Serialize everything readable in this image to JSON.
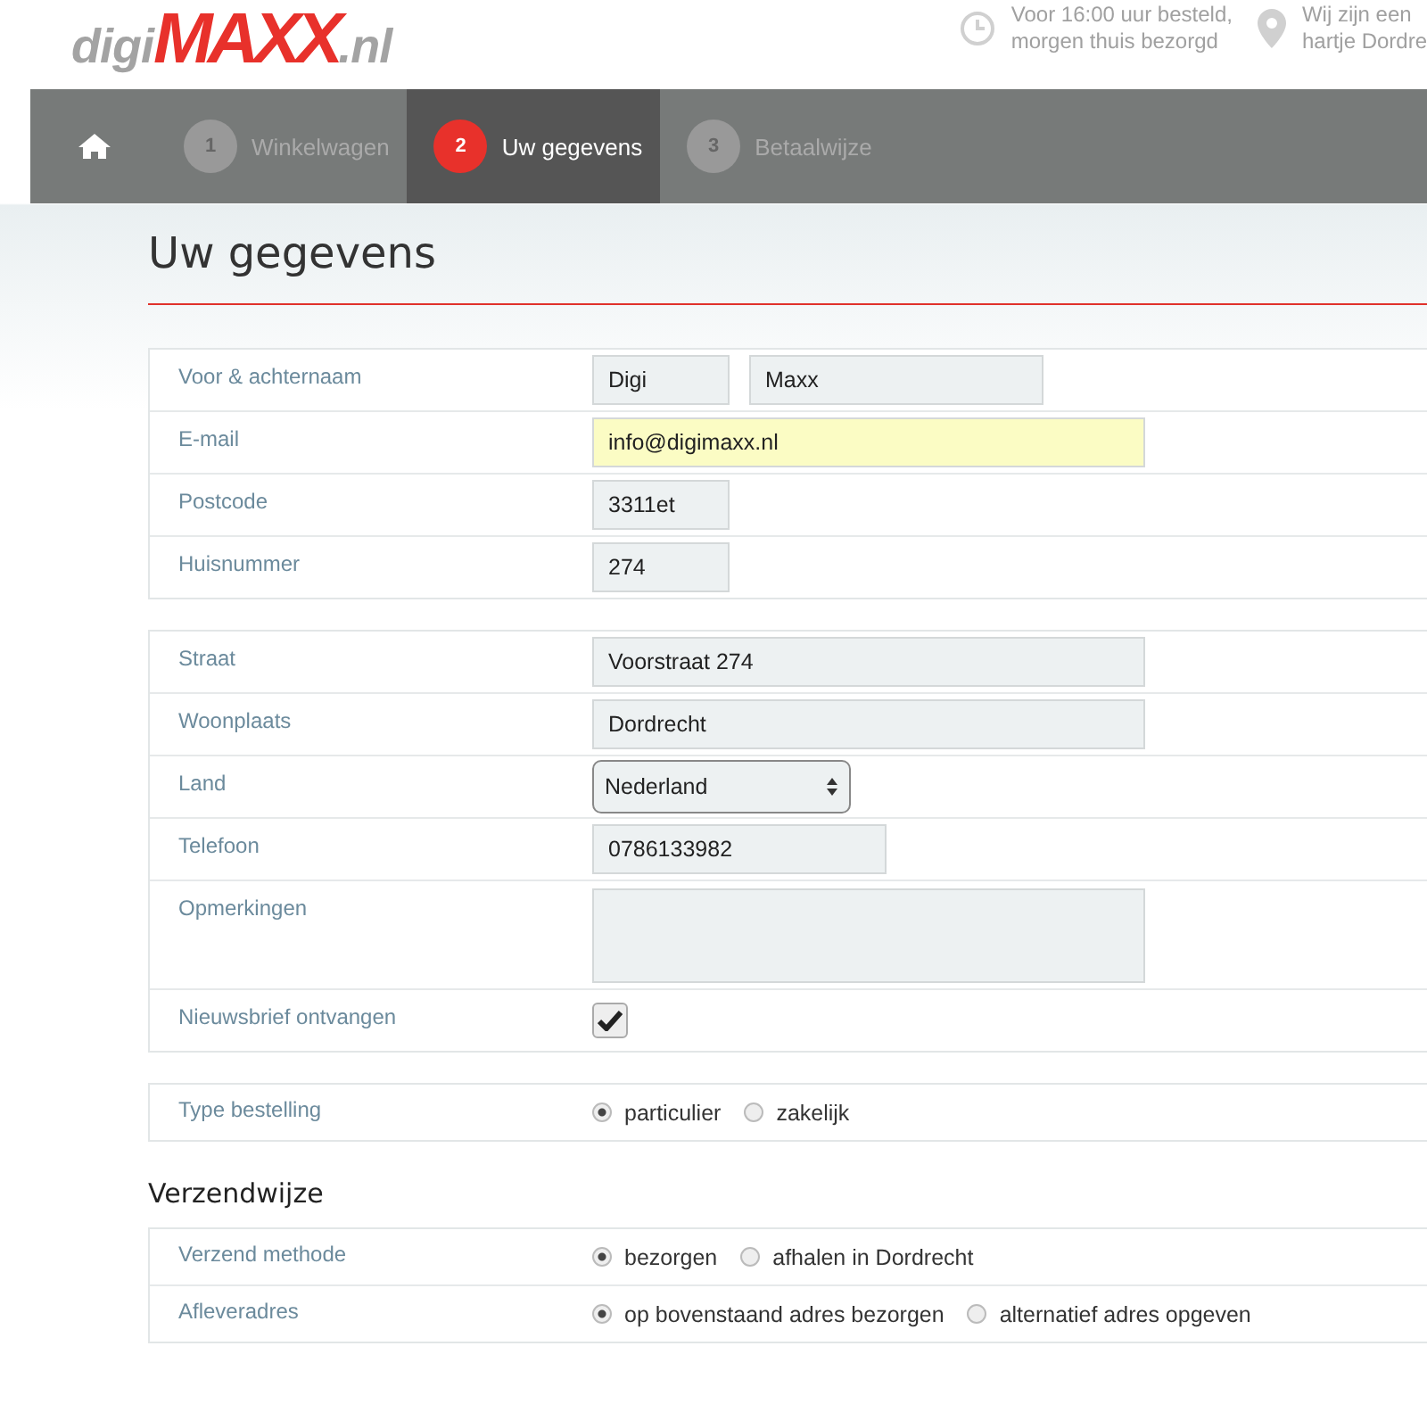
{
  "logo": [
    {
      "kind": "light",
      "text": "digi"
    },
    {
      "kind": "brand",
      "text": "MAXX"
    },
    {
      "kind": "light",
      "text": ".nl"
    }
  ],
  "header_info": [
    {
      "kind": "clock",
      "lines": [
        "Voor 16:00 uur besteld,",
        "morgen thuis bezorgd"
      ]
    },
    {
      "kind": "pin",
      "lines": [
        "Wij zijn een",
        "hartje Dordre"
      ]
    }
  ],
  "steps": [
    {
      "kind": "home"
    },
    {
      "kind": "step",
      "number": "1",
      "label": "Winkelwagen",
      "selected": false
    },
    {
      "kind": "step",
      "number": "2",
      "label": "Uw gegevens",
      "selected": true
    },
    {
      "kind": "step",
      "number": "3",
      "label": "Betaalwijze",
      "selected": false
    }
  ],
  "title": "Uw gegevens",
  "sections": [
    {
      "rows": [
        {
          "kind": "text",
          "label": "Voor & achternaam",
          "inputs": [
            {
              "value": "Digi",
              "kind": "short",
              "autofilled": false
            },
            {
              "value": "Maxx",
              "kind": "medium",
              "autofilled": false
            }
          ]
        },
        {
          "kind": "text",
          "label": "E-mail",
          "inputs": [
            {
              "value": "info@digimaxx.nl",
              "kind": "long",
              "autofilled": true
            }
          ]
        },
        {
          "kind": "text",
          "label": "Postcode",
          "inputs": [
            {
              "value": "3311et",
              "kind": "short",
              "autofilled": false
            }
          ]
        },
        {
          "kind": "text",
          "label": "Huisnummer",
          "inputs": [
            {
              "value": "274",
              "kind": "short",
              "autofilled": false
            }
          ]
        }
      ]
    },
    {
      "rows": [
        {
          "kind": "text",
          "label": "Straat",
          "inputs": [
            {
              "value": "Voorstraat 274",
              "kind": "long",
              "autofilled": false
            }
          ]
        },
        {
          "kind": "text",
          "label": "Woonplaats",
          "inputs": [
            {
              "value": "Dordrecht",
              "kind": "long",
              "autofilled": false
            }
          ]
        },
        {
          "kind": "select",
          "label": "Land",
          "value": "Nederland"
        },
        {
          "kind": "text",
          "label": "Telefoon",
          "inputs": [
            {
              "value": "0786133982",
              "kind": "medium",
              "autofilled": false
            }
          ]
        },
        {
          "kind": "textarea",
          "label": "Opmerkingen"
        },
        {
          "kind": "checkbox",
          "label": "Nieuwsbrief ontvangen",
          "checked": true
        }
      ]
    },
    {
      "rows": [
        {
          "kind": "radio",
          "label": "Type bestelling",
          "options": [
            {
              "label": "particulier",
              "selected": true
            },
            {
              "label": "zakelijk",
              "selected": false
            }
          ]
        }
      ]
    },
    {
      "heading": "Verzendwijze",
      "rows": [
        {
          "kind": "radio",
          "label": "Verzend methode",
          "options": [
            {
              "label": "bezorgen",
              "selected": true
            },
            {
              "label": "afhalen in Dordrecht",
              "selected": false
            }
          ]
        },
        {
          "kind": "radio",
          "label": "Afleveradres",
          "options": [
            {
              "label": "op bovenstaand adres bezorgen",
              "selected": true
            },
            {
              "label": "alternatief adres opgeven",
              "selected": false
            }
          ]
        }
      ]
    }
  ]
}
